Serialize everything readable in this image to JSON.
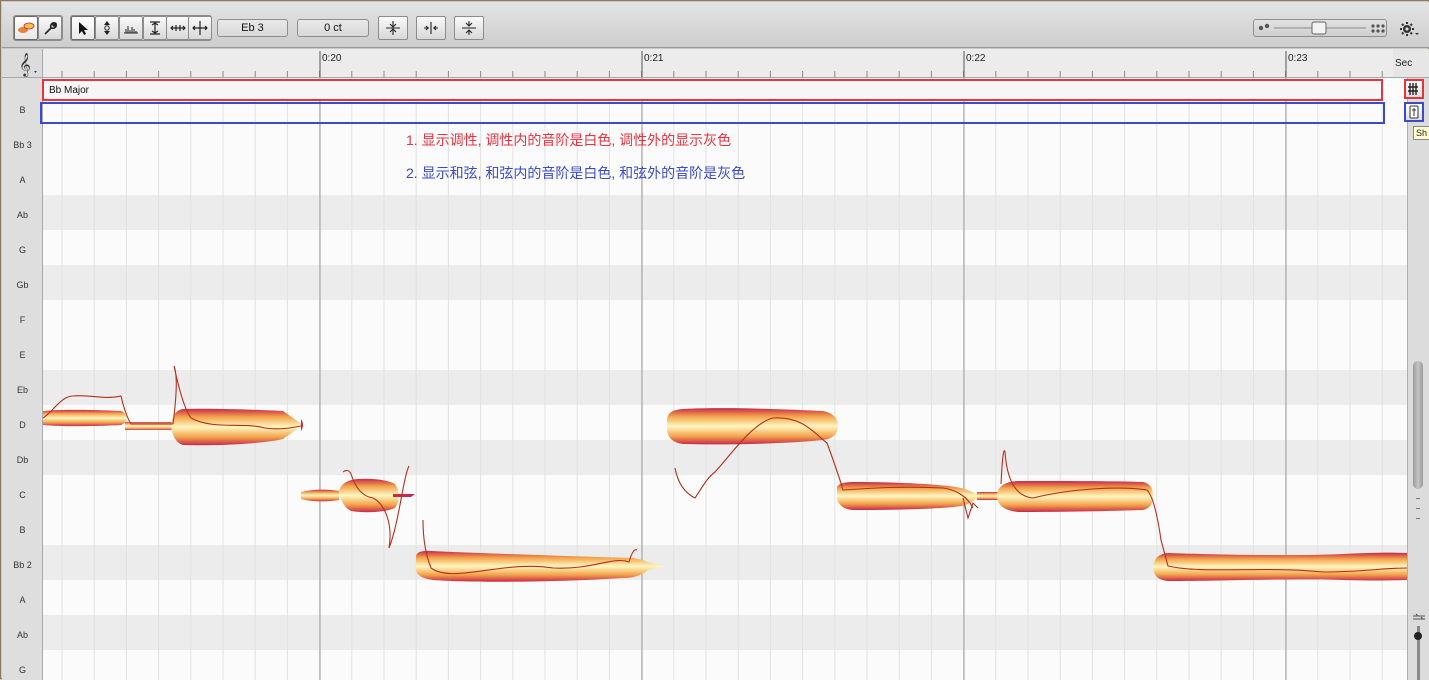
{
  "toolbar": {
    "pitch_value": "Eb 3",
    "cent_value": "0 ct"
  },
  "timeline": {
    "unit": "Sec",
    "marks": [
      "0:20",
      "0:21",
      "0:22",
      "0:23"
    ]
  },
  "scale": {
    "key_label": "Bb Major"
  },
  "chord_row_label": "B",
  "pitch_rows": [
    "Bb 3",
    "A",
    "Ab",
    "G",
    "Gb",
    "F",
    "E",
    "Eb",
    "D",
    "Db",
    "C",
    "B",
    "Bb 2",
    "A",
    "Ab",
    "G"
  ],
  "annotations": {
    "note1": "1. 显示调性, 调性内的音阶是白色, 调性外的显示灰色",
    "note2": "2. 显示和弦, 和弦内的音阶是白色, 和弦外的音阶是灰色"
  },
  "tooltip_fragment": "Sh",
  "colors": {
    "annotation_red": "#e8333f",
    "annotation_blue": "#3b4bc4",
    "blob_edge": "#c8284a",
    "blob_core": "#fff7c0",
    "pitch_curve": "#b2301e"
  },
  "icons": {
    "tool_scale": "key-signature-icon",
    "tool_chord": "chord-track-icon",
    "clef": "treble-clef-icon"
  }
}
